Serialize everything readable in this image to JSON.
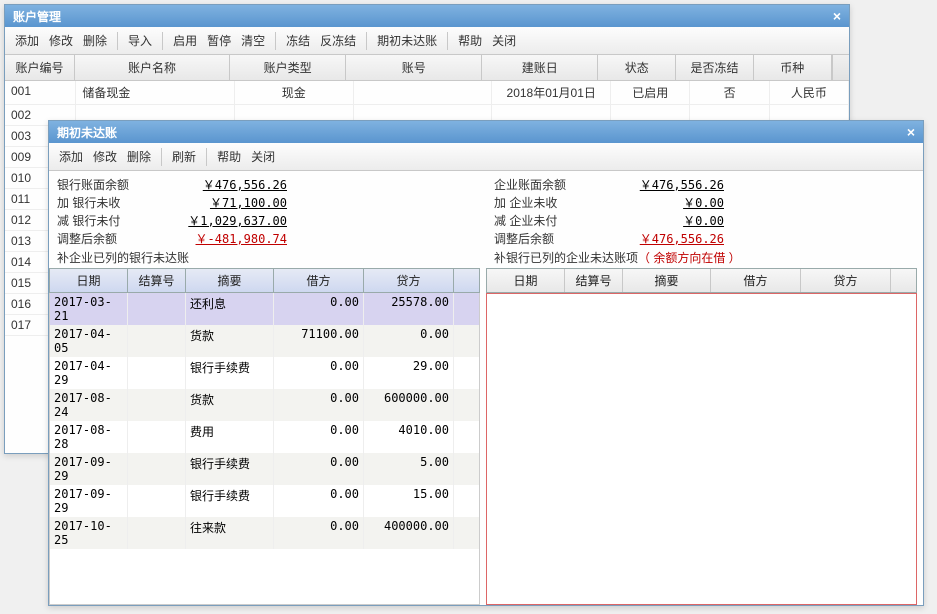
{
  "bgWindow": {
    "title": "账户管理",
    "toolbar": [
      "添加",
      "修改",
      "删除",
      "|",
      "导入",
      "|",
      "启用",
      "暂停",
      "清空",
      "|",
      "冻结",
      "反冻结",
      "|",
      "期初未达账",
      "|",
      "帮助",
      "关闭"
    ],
    "highlightIndex": 12,
    "columns": [
      "账户编号",
      "账户名称",
      "账户类型",
      "账号",
      "建账日",
      "状态",
      "是否冻结",
      "币种"
    ],
    "rows": [
      {
        "id": "001",
        "name": "储备现金",
        "type": "现金",
        "no": "",
        "date": "2018年01月01日",
        "status": "已启用",
        "frozen": "否",
        "cur": "人民币"
      },
      {
        "id": "002"
      },
      {
        "id": "003"
      },
      {
        "id": "009"
      },
      {
        "id": "010"
      },
      {
        "id": "011"
      },
      {
        "id": "012"
      },
      {
        "id": "013"
      },
      {
        "id": "014"
      },
      {
        "id": "015"
      },
      {
        "id": "016"
      },
      {
        "id": "017"
      }
    ]
  },
  "fgWindow": {
    "title": "期初未达账",
    "toolbar": [
      "添加",
      "修改",
      "删除",
      "|",
      "刷新",
      "|",
      "帮助",
      "关闭"
    ],
    "left": {
      "lines": [
        {
          "label": "银行账面余额",
          "value": "￥476,556.26"
        },
        {
          "label": "加 银行未收",
          "value": "￥71,100.00"
        },
        {
          "label": "减 银行未付",
          "value": "￥1,029,637.00"
        },
        {
          "label": "调整后余额",
          "value": "￥-481,980.74",
          "neg": true
        }
      ],
      "section": "补企业已列的银行未达账",
      "headers": [
        "日期",
        "结算号",
        "摘要",
        "借方",
        "贷方"
      ],
      "rows": [
        {
          "date": "2017-03-21",
          "set": "",
          "sum": "还利息",
          "deb": "0.00",
          "cre": "25578.00",
          "sel": true
        },
        {
          "date": "2017-04-05",
          "set": "",
          "sum": "货款",
          "deb": "71100.00",
          "cre": "0.00"
        },
        {
          "date": "2017-04-29",
          "set": "",
          "sum": "银行手续费",
          "deb": "0.00",
          "cre": "29.00"
        },
        {
          "date": "2017-08-24",
          "set": "",
          "sum": "货款",
          "deb": "0.00",
          "cre": "600000.00"
        },
        {
          "date": "2017-08-28",
          "set": "",
          "sum": "费用",
          "deb": "0.00",
          "cre": "4010.00"
        },
        {
          "date": "2017-09-29",
          "set": "",
          "sum": "银行手续费",
          "deb": "0.00",
          "cre": "5.00"
        },
        {
          "date": "2017-09-29",
          "set": "",
          "sum": "银行手续费",
          "deb": "0.00",
          "cre": "15.00"
        },
        {
          "date": "2017-10-25",
          "set": "",
          "sum": "往来款",
          "deb": "0.00",
          "cre": "400000.00"
        }
      ]
    },
    "right": {
      "lines": [
        {
          "label": "企业账面余额",
          "value": "￥476,556.26"
        },
        {
          "label": "加 企业未收",
          "value": "￥0.00"
        },
        {
          "label": "减 企业未付",
          "value": "￥0.00"
        },
        {
          "label": "调整后余额",
          "value": "￥476,556.26",
          "red": true
        }
      ],
      "section": "补银行已列的企业未达账项",
      "sectionNote": "（ 余额方向在借    ）",
      "headers": [
        "日期",
        "结算号",
        "摘要",
        "借方",
        "贷方"
      ]
    }
  }
}
